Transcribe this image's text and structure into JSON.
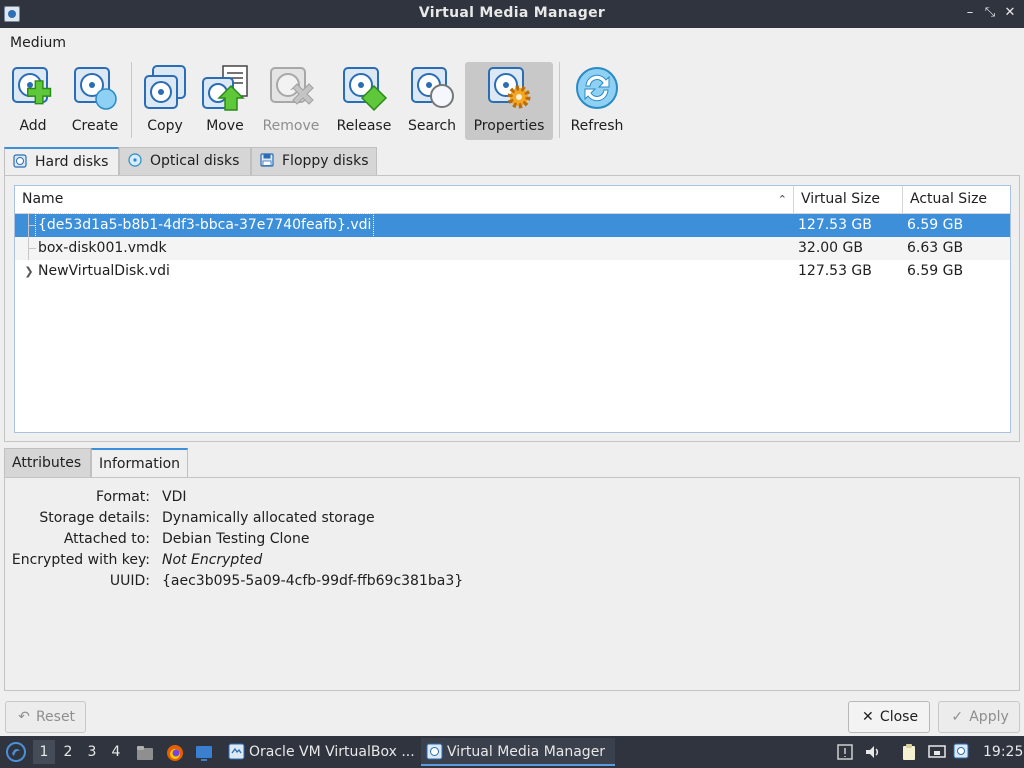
{
  "window": {
    "title": "Virtual Media Manager"
  },
  "menu": {
    "items": [
      "Medium"
    ]
  },
  "toolbar": {
    "add": "Add",
    "create": "Create",
    "copy": "Copy",
    "move": "Move",
    "remove": "Remove",
    "release": "Release",
    "search": "Search",
    "properties": "Properties",
    "refresh": "Refresh"
  },
  "media_tabs": {
    "hard_disks": "Hard disks",
    "optical_disks": "Optical disks",
    "floppy_disks": "Floppy disks"
  },
  "table": {
    "columns": {
      "name": "Name",
      "virtual_size": "Virtual Size",
      "actual_size": "Actual Size"
    },
    "rows": [
      {
        "name": "{de53d1a5-b8b1-4df3-bbca-37e7740feafb}.vdi",
        "virtual_size": "127.53 GB",
        "actual_size": "6.59 GB"
      },
      {
        "name": "box-disk001.vmdk",
        "virtual_size": "32.00 GB",
        "actual_size": "6.63 GB"
      },
      {
        "name": "NewVirtualDisk.vdi",
        "virtual_size": "127.53 GB",
        "actual_size": "6.59 GB"
      }
    ]
  },
  "detail_tabs": {
    "attributes": "Attributes",
    "information": "Information"
  },
  "details": {
    "format_label": "Format:",
    "format_value": "VDI",
    "storage_label": "Storage details:",
    "storage_value": "Dynamically allocated storage",
    "attached_label": "Attached to:",
    "attached_value": "Debian Testing Clone",
    "encrypted_label": "Encrypted with key:",
    "encrypted_value": "Not Encrypted",
    "uuid_label": "UUID:",
    "uuid_value": "{aec3b095-5a09-4cfb-99df-ffb69c381ba3}"
  },
  "buttons": {
    "reset": "Reset",
    "close": "Close",
    "apply": "Apply"
  },
  "taskbar": {
    "workspaces": [
      "1",
      "2",
      "3",
      "4"
    ],
    "tasks": [
      "Oracle VM VirtualBox ...",
      "Virtual Media Manager"
    ],
    "clock": "19:25"
  },
  "colors": {
    "accent": "#3c8fd8",
    "titlebar": "#2f343f",
    "selection": "#3c8fd8"
  }
}
